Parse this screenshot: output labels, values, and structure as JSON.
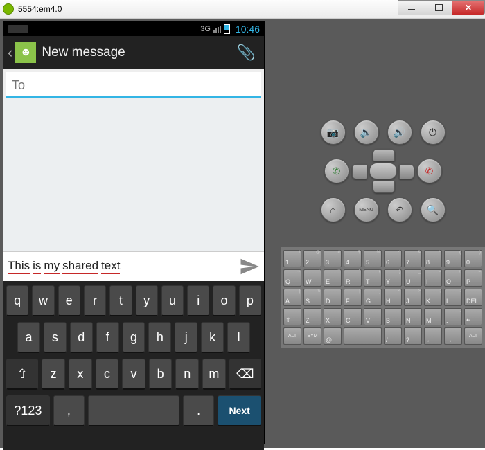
{
  "window": {
    "title": "5554:em4.0"
  },
  "statusbar": {
    "net": "3G",
    "time": "10:46"
  },
  "header": {
    "title": "New message"
  },
  "compose": {
    "to_placeholder": "To",
    "message_text": "This is my shared text",
    "words": [
      "This",
      "is",
      "my",
      "shared",
      "text"
    ]
  },
  "soft_keyboard": {
    "row1": [
      "q",
      "w",
      "e",
      "r",
      "t",
      "y",
      "u",
      "i",
      "o",
      "p"
    ],
    "row2": [
      "a",
      "s",
      "d",
      "f",
      "g",
      "h",
      "j",
      "k",
      "l"
    ],
    "row3_shift": "⇧",
    "row3": [
      "z",
      "x",
      "c",
      "v",
      "b",
      "n",
      "m"
    ],
    "row3_del": "⌫",
    "row4_sym": "?123",
    "row4_comma": ",",
    "row4_period": ".",
    "row4_next": "Next"
  },
  "controls": {
    "top": [
      "camera",
      "vol-down",
      "vol-up",
      "power"
    ],
    "call": "call",
    "hangup": "hangup",
    "bottom": [
      "home",
      "menu",
      "back",
      "search"
    ],
    "menu_label": "MENU"
  },
  "hw_keyboard": {
    "r1": [
      [
        "1",
        "!"
      ],
      [
        "2",
        "@"
      ],
      [
        "3",
        "#"
      ],
      [
        "4",
        "$"
      ],
      [
        "5",
        "%"
      ],
      [
        "6",
        "^"
      ],
      [
        "7",
        "&"
      ],
      [
        "8",
        "*"
      ],
      [
        "9",
        "("
      ],
      [
        "0",
        ")"
      ]
    ],
    "r2": [
      [
        "Q",
        "~"
      ],
      [
        "W",
        "´"
      ],
      [
        "E",
        "¯"
      ],
      [
        "R",
        "ˇ"
      ],
      [
        "T",
        "{"
      ],
      [
        "Y",
        "}"
      ],
      [
        "U",
        "_"
      ],
      [
        "I",
        "-"
      ],
      [
        "O",
        "+"
      ],
      [
        "P",
        "="
      ]
    ],
    "r3": [
      [
        "A",
        "|"
      ],
      [
        "S",
        "\\\\"
      ],
      [
        "D",
        ""
      ],
      [
        "F",
        "["
      ],
      [
        "G",
        "]"
      ],
      [
        "H",
        "<"
      ],
      [
        "J",
        ">"
      ],
      [
        "K",
        ";"
      ],
      [
        "L",
        ":"
      ],
      [
        "DEL",
        ""
      ]
    ],
    "r4": [
      [
        "⇧",
        ""
      ],
      [
        "Z",
        ""
      ],
      [
        "X",
        ""
      ],
      [
        "C",
        ""
      ],
      [
        "V",
        ""
      ],
      [
        "B",
        ""
      ],
      [
        "N",
        ""
      ],
      [
        "M",
        ""
      ],
      [
        ".",
        ","
      ],
      [
        "↵",
        ""
      ]
    ],
    "r5": [
      "ALT",
      "SYM",
      "@",
      " ",
      "/",
      "?",
      "←",
      "→",
      "ALT"
    ]
  }
}
